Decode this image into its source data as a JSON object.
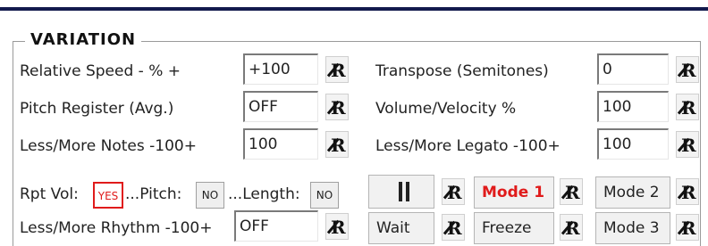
{
  "panel": {
    "title": "VARIATION",
    "rows": [
      {
        "label": "Relative Speed - % +",
        "value": "+100"
      },
      {
        "label": "Pitch Register (Avg.)",
        "value": "OFF"
      },
      {
        "label": "Less/More Notes -100+",
        "value": "100"
      },
      {
        "label": "Less/More Rhythm -100+",
        "value": "OFF"
      }
    ],
    "right_rows": [
      {
        "label": "Transpose (Semitones)",
        "value": "0"
      },
      {
        "label": "Volume/Velocity %",
        "value": "100"
      },
      {
        "label": "Less/More Legato -100+",
        "value": "100"
      }
    ],
    "repeat": {
      "vol_label": "Rpt Vol:",
      "vol_value": "YES",
      "pitch_label": "...Pitch:",
      "pitch_value": "NO",
      "length_label": "...Length:",
      "length_value": "NO"
    },
    "reset_label": "R",
    "buttons": {
      "wait": "Wait",
      "freeze": "Freeze",
      "mode1": "Mode 1",
      "mode2": "Mode 2",
      "mode3": "Mode 3"
    }
  },
  "colors": {
    "accent_red": "#e01b1b",
    "top_bar": "#131a4d"
  }
}
